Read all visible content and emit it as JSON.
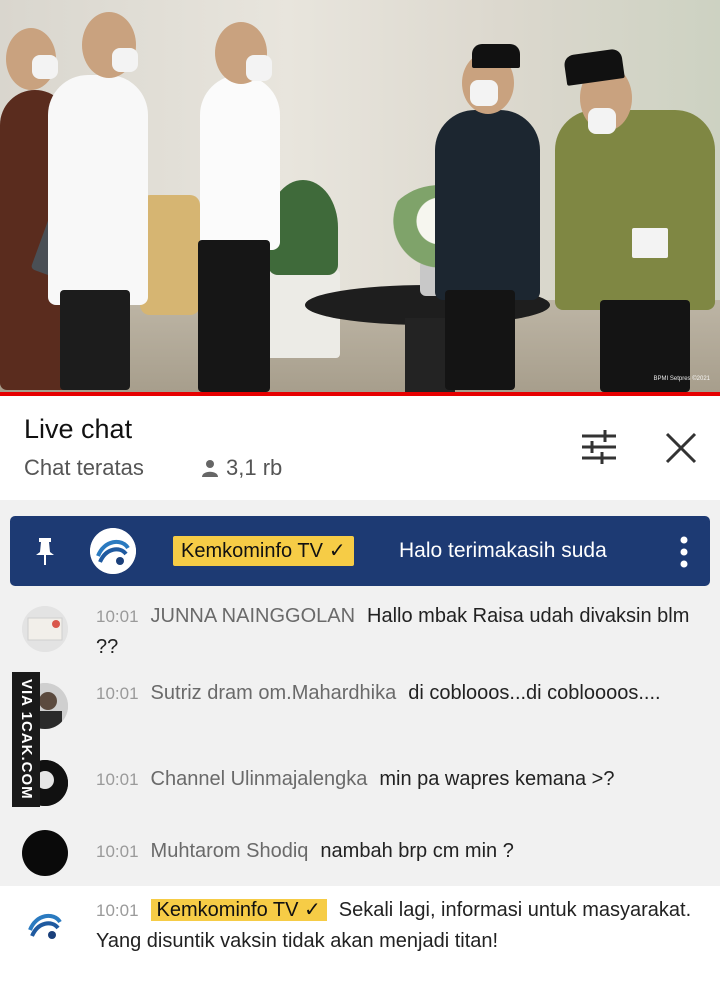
{
  "video": {
    "watermark": "BPMI Setpres ©2021"
  },
  "live_chat": {
    "title": "Live chat",
    "mode": "Chat teratas",
    "viewers": "3,1 rb",
    "icons": {
      "filter": "filter-sliders-icon",
      "close": "close-icon",
      "viewers": "person-icon"
    }
  },
  "pinned": {
    "author": "Kemkominfo TV",
    "verified": "✓",
    "message": "Halo terimakasih suda",
    "colors": {
      "background": "#1d3a73",
      "badge": "#f6cc46"
    }
  },
  "messages": [
    {
      "time": "10:01",
      "author": "JUNNA NAINGGOLAN",
      "text": "Hallo mbak Raisa udah divaksin blm ??"
    },
    {
      "time": "10:01",
      "author": "Sutriz dram om.Mahardhika",
      "text": "di coblooos...di cobloooos...."
    },
    {
      "time": "10:01",
      "author": "Channel Ulinmajalengka",
      "text": "min pa wapres kemana >?"
    },
    {
      "time": "10:01",
      "author": "Muhtarom Shodiq",
      "text": "nambah brp cm min ?"
    },
    {
      "time": "10:01",
      "author": "Kemkominfo TV",
      "verified": "✓",
      "text": "Sekali lagi, informasi untuk masyarakat. Yang disuntik vaksin tidak akan menjadi titan!"
    }
  ],
  "side_watermark": "VIA 1CAK.COM"
}
